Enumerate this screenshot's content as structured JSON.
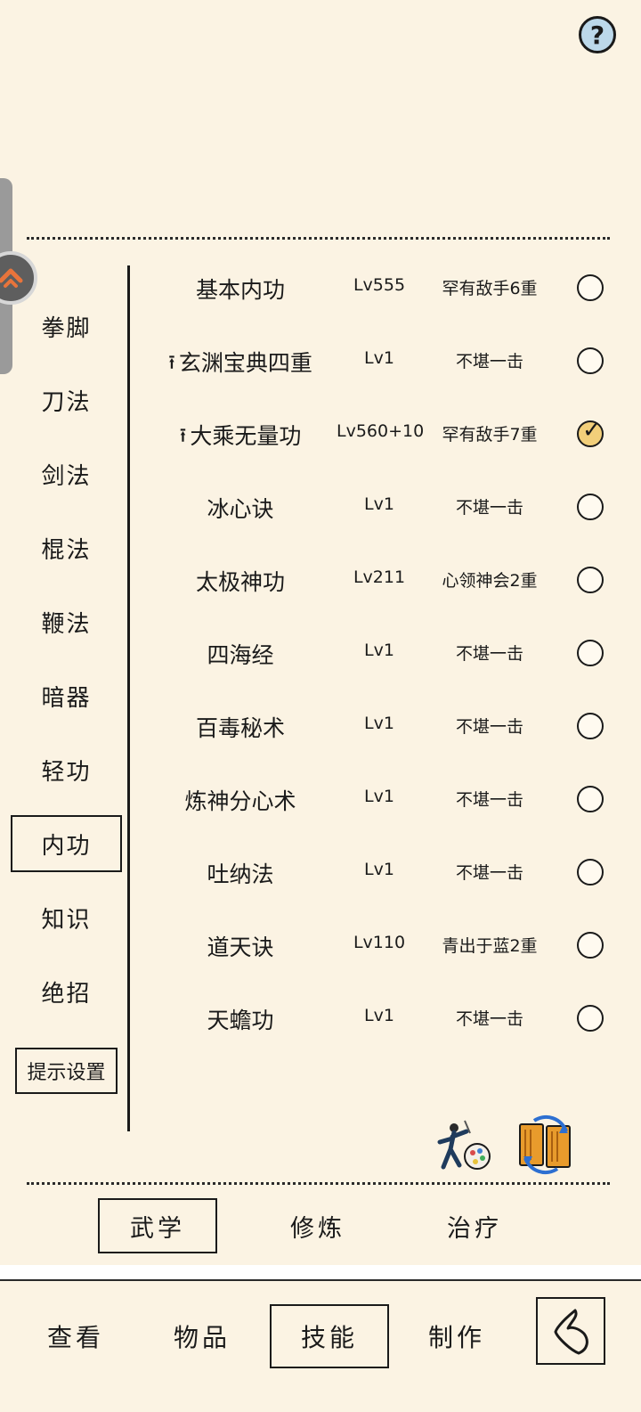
{
  "help": {
    "glyph": "?"
  },
  "categories": [
    {
      "label": "拳脚",
      "active": false
    },
    {
      "label": "刀法",
      "active": false
    },
    {
      "label": "剑法",
      "active": false
    },
    {
      "label": "棍法",
      "active": false
    },
    {
      "label": "鞭法",
      "active": false
    },
    {
      "label": "暗器",
      "active": false
    },
    {
      "label": "轻功",
      "active": false
    },
    {
      "label": "内功",
      "active": true
    },
    {
      "label": "知识",
      "active": false
    },
    {
      "label": "绝招",
      "active": false
    }
  ],
  "hint_settings_label": "提示设置",
  "skills": [
    {
      "name": "基本内功",
      "level": "Lv555",
      "rank": "罕有敌手6重",
      "upgradable": false,
      "checked": false
    },
    {
      "name": "玄渊宝典四重",
      "level": "Lv1",
      "rank": "不堪一击",
      "upgradable": true,
      "checked": false
    },
    {
      "name": "大乘无量功",
      "level": "Lv560+10",
      "rank": "罕有敌手7重",
      "upgradable": true,
      "checked": true
    },
    {
      "name": "冰心诀",
      "level": "Lv1",
      "rank": "不堪一击",
      "upgradable": false,
      "checked": false
    },
    {
      "name": "太极神功",
      "level": "Lv211",
      "rank": "心领神会2重",
      "upgradable": false,
      "checked": false
    },
    {
      "name": "四海经",
      "level": "Lv1",
      "rank": "不堪一击",
      "upgradable": false,
      "checked": false
    },
    {
      "name": "百毒秘术",
      "level": "Lv1",
      "rank": "不堪一击",
      "upgradable": false,
      "checked": false
    },
    {
      "name": "炼神分心术",
      "level": "Lv1",
      "rank": "不堪一击",
      "upgradable": false,
      "checked": false
    },
    {
      "name": "吐纳法",
      "level": "Lv1",
      "rank": "不堪一击",
      "upgradable": false,
      "checked": false
    },
    {
      "name": "道天诀",
      "level": "Lv110",
      "rank": "青出于蓝2重",
      "upgradable": false,
      "checked": false
    },
    {
      "name": "天蟾功",
      "level": "Lv1",
      "rank": "不堪一击",
      "upgradable": false,
      "checked": false
    }
  ],
  "icons": {
    "upgrade": "up-arrow-icon",
    "check": "checkmark-icon",
    "tool_a": "martial-artist-palette-icon",
    "tool_b": "book-swap-icon",
    "back": "back-arrow-icon"
  },
  "sub_tabs": [
    {
      "label": "武学",
      "active": true
    },
    {
      "label": "修炼",
      "active": false
    },
    {
      "label": "治疗",
      "active": false
    }
  ],
  "bottom_nav": [
    {
      "label": "查看",
      "active": false
    },
    {
      "label": "物品",
      "active": false
    },
    {
      "label": "技能",
      "active": true
    },
    {
      "label": "制作",
      "active": false
    }
  ],
  "colors": {
    "background": "#fbf3e3",
    "ink": "#1a1a1a",
    "help_fill": "#bcd8ea",
    "checked_fill": "#f2cf7a"
  }
}
